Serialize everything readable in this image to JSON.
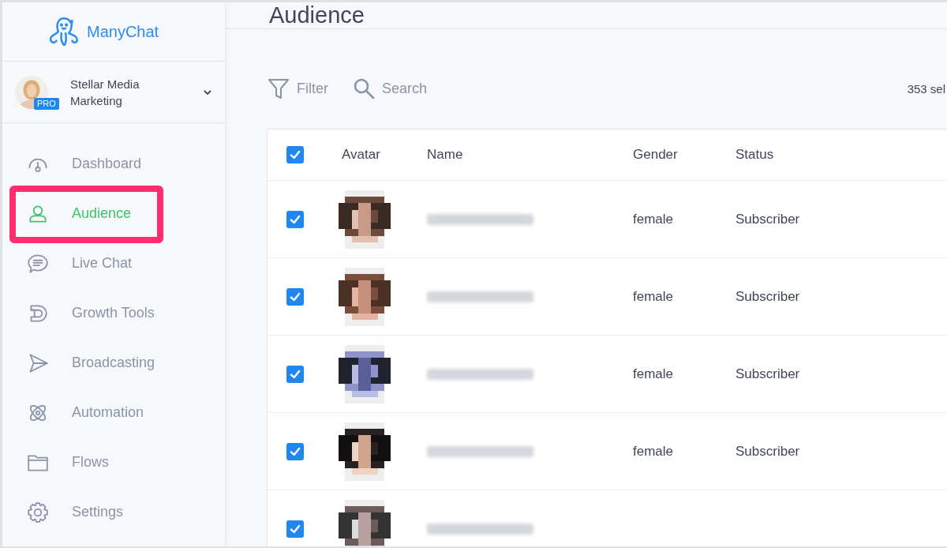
{
  "brand": {
    "name": "ManyChat"
  },
  "account": {
    "name": "Stellar Media Marketing",
    "badge": "PRO"
  },
  "nav": [
    {
      "label": "Dashboard",
      "selected": false
    },
    {
      "label": "Audience",
      "selected": true
    },
    {
      "label": "Live Chat",
      "selected": false
    },
    {
      "label": "Growth Tools",
      "selected": false
    },
    {
      "label": "Broadcasting",
      "selected": false
    },
    {
      "label": "Automation",
      "selected": false
    },
    {
      "label": "Flows",
      "selected": false
    },
    {
      "label": "Settings",
      "selected": false
    }
  ],
  "page_title": "Audience",
  "toolbar": {
    "filter": "Filter",
    "search": "Search",
    "selection_count": "353 sel"
  },
  "table": {
    "all_checked": true,
    "columns": [
      "Avatar",
      "Name",
      "Gender",
      "Status"
    ],
    "rows": [
      {
        "checked": true,
        "gender": "female",
        "status": "Subscriber"
      },
      {
        "checked": true,
        "gender": "female",
        "status": "Subscriber"
      },
      {
        "checked": true,
        "gender": "female",
        "status": "Subscriber"
      },
      {
        "checked": true,
        "gender": "female",
        "status": "Subscriber"
      },
      {
        "checked": true
      }
    ]
  }
}
